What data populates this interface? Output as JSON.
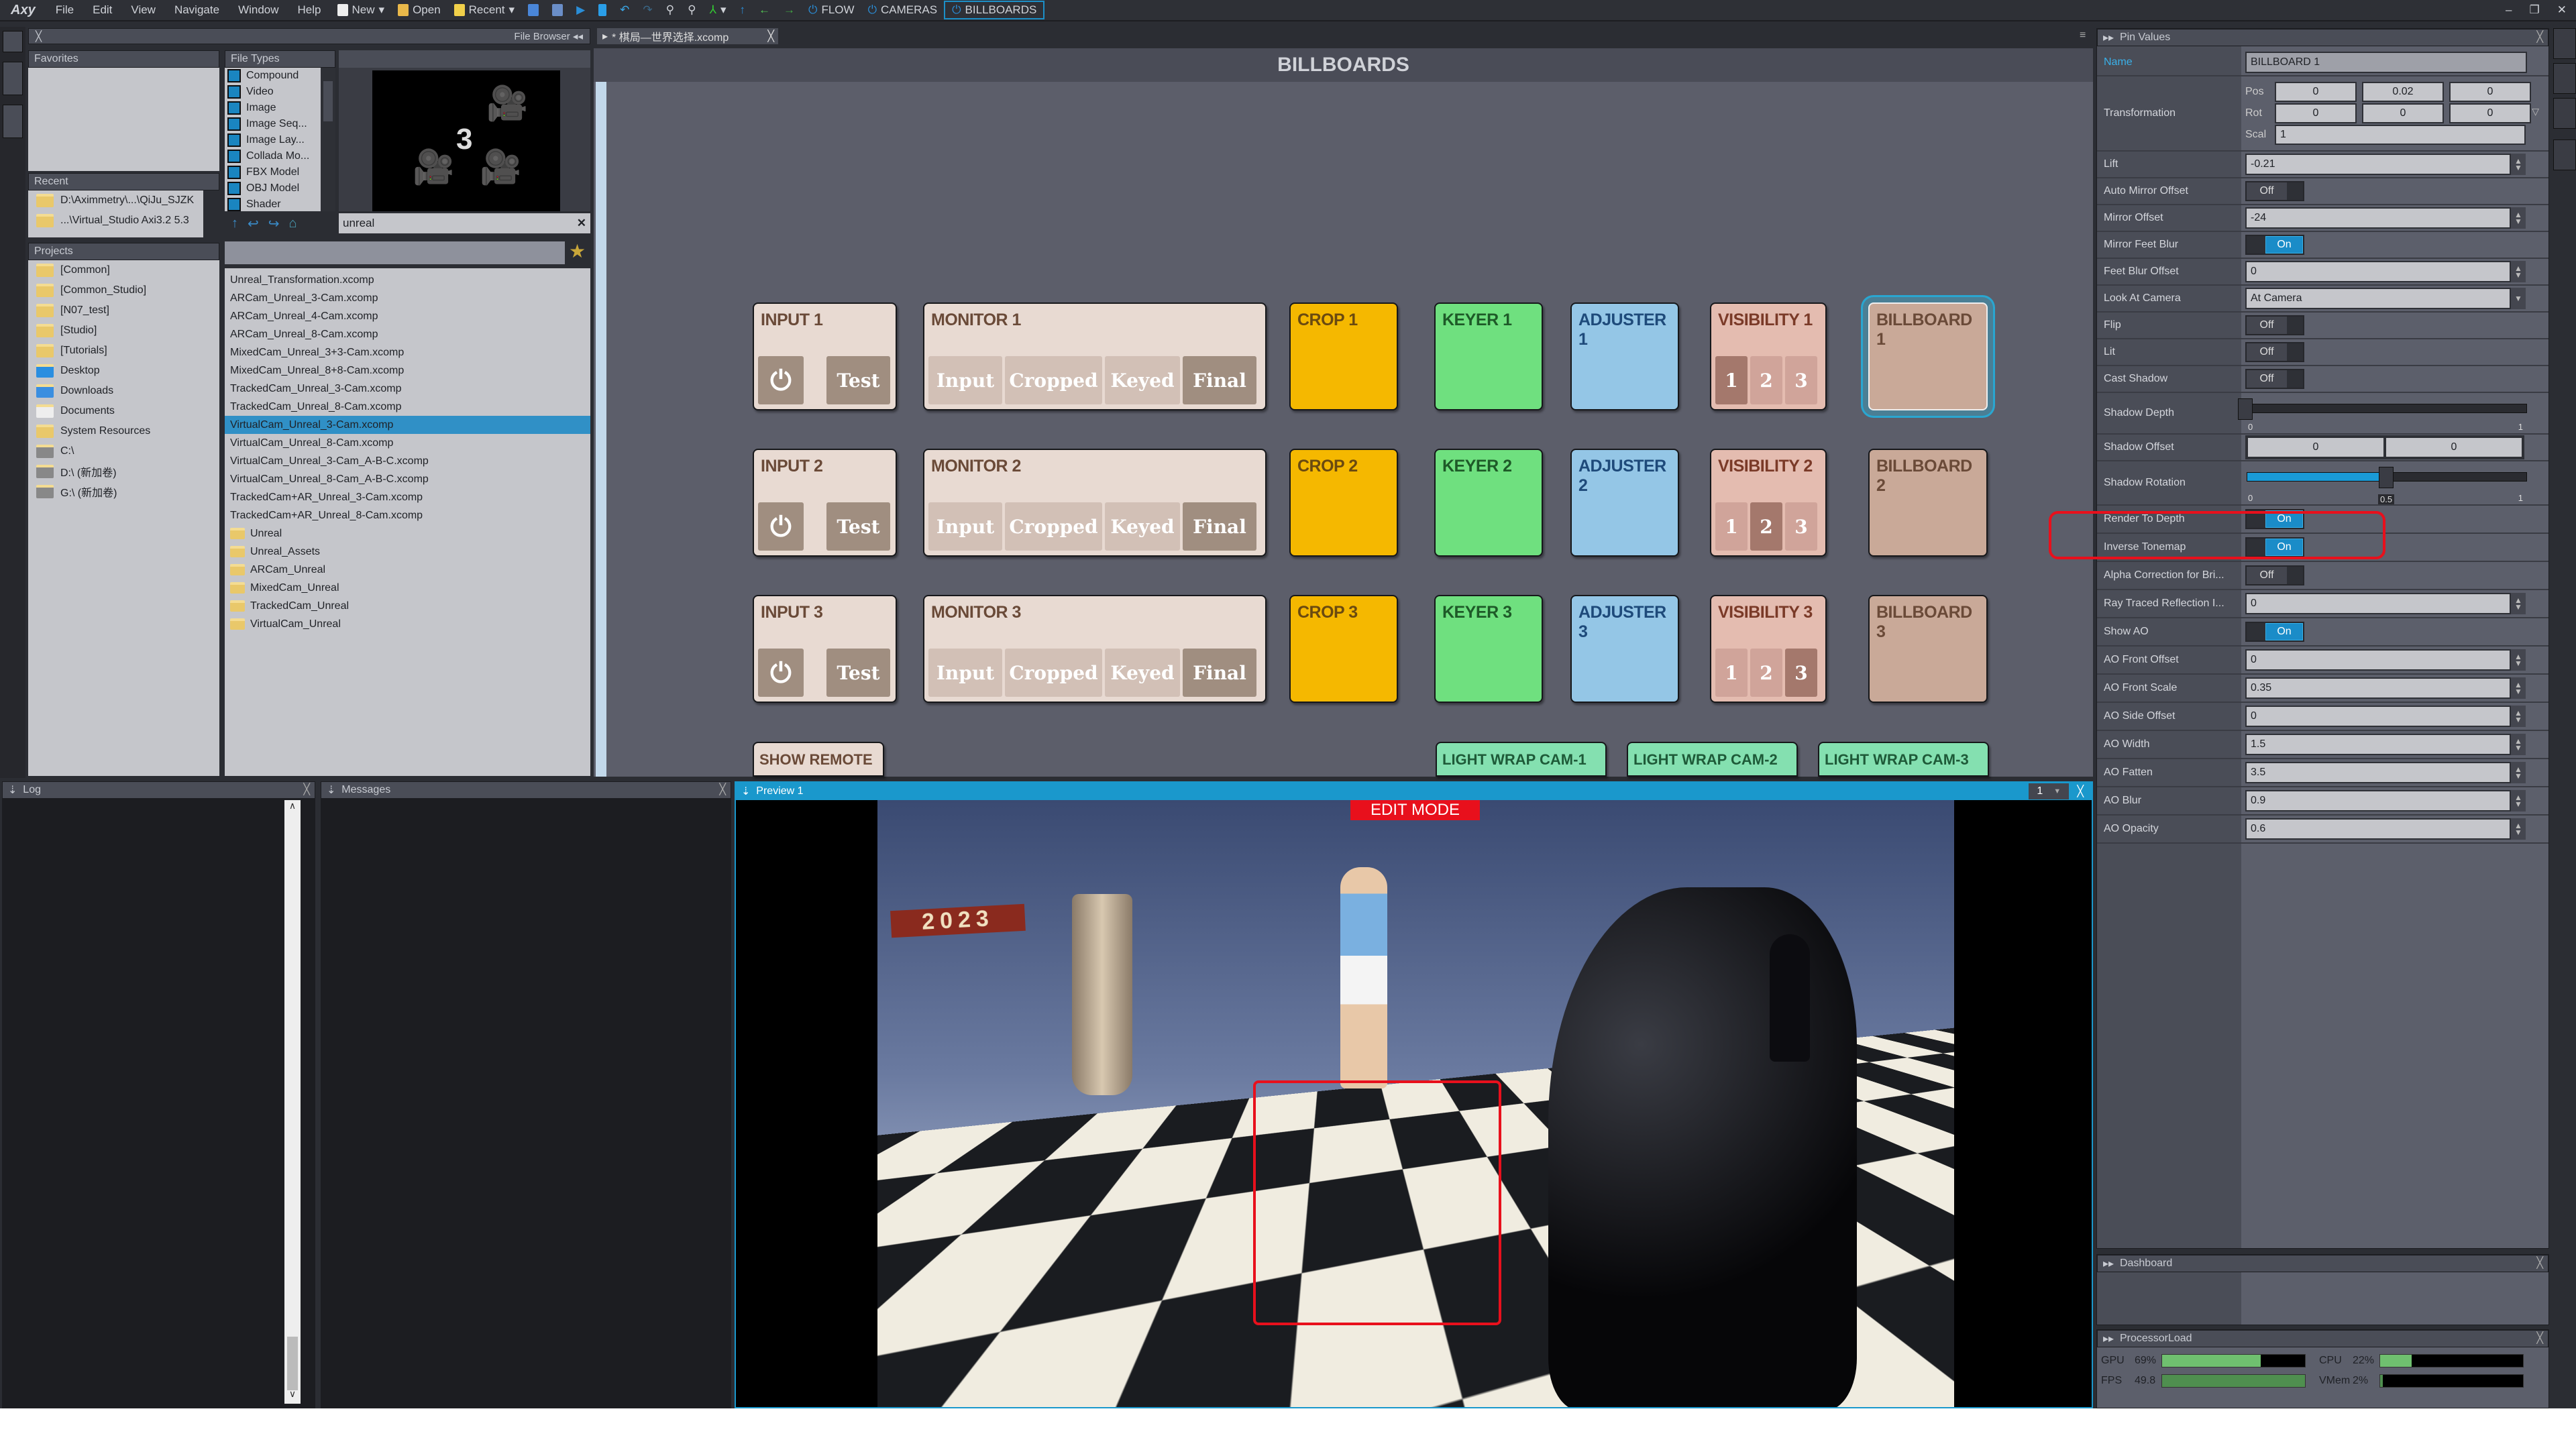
{
  "menu": {
    "logo": "Axy",
    "items": [
      "File",
      "Edit",
      "View",
      "Navigate",
      "Window",
      "Help"
    ],
    "toolbar": {
      "new": "New",
      "open": "Open",
      "recent": "Recent",
      "flow": "FLOW",
      "cameras": "CAMERAS",
      "billboards": "BILLBOARDS"
    }
  },
  "file_browser": {
    "title": "File Browser",
    "favorites_title": "Favorites",
    "recent_title": "Recent",
    "recent": [
      "D:\\Aximmetry\\...\\QiJu_SJZK",
      "...\\Virtual_Studio Axi3.2 5.3"
    ],
    "projects_title": "Projects",
    "projects": [
      {
        "label": "[Common]",
        "icon": "project-folder"
      },
      {
        "label": "[Common_Studio]",
        "icon": "project-folder"
      },
      {
        "label": "[N07_test]",
        "icon": "project-folder"
      },
      {
        "label": "[Studio]",
        "icon": "project-folder"
      },
      {
        "label": "[Tutorials]",
        "icon": "project-folder"
      },
      {
        "label": "Desktop",
        "icon": "desktop"
      },
      {
        "label": "Downloads",
        "icon": "download-arrow"
      },
      {
        "label": "Documents",
        "icon": "document"
      },
      {
        "label": "System Resources",
        "icon": "system-folder"
      },
      {
        "label": "C:\\",
        "icon": "drive"
      },
      {
        "label": "D:\\ (新加卷)",
        "icon": "drive"
      },
      {
        "label": "G:\\ (新加卷)",
        "icon": "drive"
      }
    ],
    "file_types_title": "File Types",
    "file_types": [
      "Compound",
      "Video",
      "Image",
      "Image Seq...",
      "Image Lay...",
      "Collada Mo...",
      "FBX Model",
      "OBJ Model",
      "Shader"
    ],
    "thumbnail_number": "3",
    "search_value": "unreal",
    "files": [
      "Unreal_Transformation.xcomp",
      "ARCam_Unreal_3-Cam.xcomp",
      "ARCam_Unreal_4-Cam.xcomp",
      "ARCam_Unreal_8-Cam.xcomp",
      "MixedCam_Unreal_3+3-Cam.xcomp",
      "MixedCam_Unreal_8+8-Cam.xcomp",
      "TrackedCam_Unreal_3-Cam.xcomp",
      "TrackedCam_Unreal_8-Cam.xcomp",
      "VirtualCam_Unreal_3-Cam.xcomp",
      "VirtualCam_Unreal_8-Cam.xcomp",
      "VirtualCam_Unreal_3-Cam_A-B-C.xcomp",
      "VirtualCam_Unreal_8-Cam_A-B-C.xcomp",
      "TrackedCam+AR_Unreal_3-Cam.xcomp",
      "TrackedCam+AR_Unreal_8-Cam.xcomp"
    ],
    "selected_file": "VirtualCam_Unreal_3-Cam.xcomp",
    "folders": [
      "Unreal",
      "Unreal_Assets",
      "ARCam_Unreal",
      "MixedCam_Unreal",
      "TrackedCam_Unreal",
      "VirtualCam_Unreal"
    ]
  },
  "editor": {
    "tab": "* 棋局—世界选择.xcomp",
    "title": "BILLBOARDS",
    "rows": [
      {
        "input": "INPUT 1",
        "monitor": "MONITOR 1",
        "crop": "CROP 1",
        "keyer": "KEYER 1",
        "adjuster": "ADJUSTER 1",
        "visibility": "VISIBILITY 1",
        "visibility_active": "1",
        "billboard": "BILLBOARD 1",
        "selected": true
      },
      {
        "input": "INPUT 2",
        "monitor": "MONITOR 2",
        "crop": "CROP 2",
        "keyer": "KEYER 2",
        "adjuster": "ADJUSTER 2",
        "visibility": "VISIBILITY 2",
        "visibility_active": "2",
        "billboard": "BILLBOARD 2",
        "selected": false
      },
      {
        "input": "INPUT 3",
        "monitor": "MONITOR 3",
        "crop": "CROP 3",
        "keyer": "KEYER 3",
        "adjuster": "ADJUSTER 3",
        "visibility": "VISIBILITY 3",
        "visibility_active": "3",
        "billboard": "BILLBOARD 3",
        "selected": false
      }
    ],
    "test_label": "Test",
    "monitor_buttons": [
      "Input",
      "Cropped",
      "Keyed",
      "Final"
    ],
    "monitor_active": "Final",
    "visibility_buttons": [
      "1",
      "2",
      "3"
    ],
    "show_remote": "SHOW REMOTE",
    "light_wrap": [
      "LIGHT WRAP CAM-1",
      "LIGHT WRAP CAM-2",
      "LIGHT WRAP CAM-3"
    ],
    "colors": {
      "input": "#e8dad2",
      "crop": "#f5b800",
      "keyer": "#6fe07f",
      "adjuster": "#94c6e6",
      "visibility": "#e4bcb0",
      "billboard": "#c9a998",
      "light_wrap": "#84e0b0",
      "selection": "#2aa6d0"
    }
  },
  "log": {
    "title": "Log"
  },
  "messages": {
    "title": "Messages"
  },
  "preview": {
    "title": "Preview 1",
    "index": "1",
    "edit_mode": "EDIT MODE",
    "sign": "2023"
  },
  "pin_values": {
    "title": "Pin Values",
    "name_label": "Name",
    "name_value": "BILLBOARD 1",
    "transformation": {
      "label": "Transformation",
      "pos_label": "Pos",
      "pos": [
        "0",
        "0.02",
        "0"
      ],
      "rot_label": "Rot",
      "rot": [
        "0",
        "0",
        "0"
      ],
      "scal_label": "Scal",
      "scal": "1"
    },
    "rows": [
      {
        "label": "Lift",
        "type": "number",
        "value": "-0.21"
      },
      {
        "label": "Auto Mirror Offset",
        "type": "toggle",
        "value": "Off"
      },
      {
        "label": "Mirror Offset",
        "type": "number",
        "value": "-24"
      },
      {
        "label": "Mirror Feet Blur",
        "type": "toggle",
        "value": "On"
      },
      {
        "label": "Feet Blur Offset",
        "type": "number",
        "value": "0"
      },
      {
        "label": "Look At Camera",
        "type": "select",
        "value": "At Camera"
      },
      {
        "label": "Flip",
        "type": "toggle",
        "value": "Off"
      },
      {
        "label": "Lit",
        "type": "toggle",
        "value": "Off"
      },
      {
        "label": "Cast Shadow",
        "type": "toggle",
        "value": "Off"
      },
      {
        "label": "Shadow Depth",
        "type": "slider",
        "value": 0,
        "min": "0",
        "max": "1",
        "readout": "0"
      },
      {
        "label": "Shadow Offset",
        "type": "pair",
        "values": [
          "0",
          "0"
        ]
      },
      {
        "label": "Shadow Rotation",
        "type": "slider",
        "value": 0.5,
        "min": "0",
        "max": "1",
        "readout": "0.5"
      },
      {
        "label": "Render To Depth",
        "type": "toggle",
        "value": "On",
        "highlighted": true
      },
      {
        "label": "Inverse Tonemap",
        "type": "toggle",
        "value": "On"
      },
      {
        "label": "Alpha Correction for Bri...",
        "type": "toggle",
        "value": "Off"
      },
      {
        "label": "Ray Traced Reflection I...",
        "type": "number",
        "value": "0"
      },
      {
        "label": "Show AO",
        "type": "toggle",
        "value": "On"
      },
      {
        "label": "AO Front Offset",
        "type": "number",
        "value": "0"
      },
      {
        "label": "AO Front Scale",
        "type": "number",
        "value": "0.35"
      },
      {
        "label": "AO Side Offset",
        "type": "number",
        "value": "0"
      },
      {
        "label": "AO Width",
        "type": "number",
        "value": "1.5"
      },
      {
        "label": "AO Fatten",
        "type": "number",
        "value": "3.5"
      },
      {
        "label": "AO Blur",
        "type": "number",
        "value": "0.9"
      },
      {
        "label": "AO Opacity",
        "type": "number",
        "value": "0.6"
      }
    ]
  },
  "dashboard": {
    "title": "Dashboard"
  },
  "processor_load": {
    "title": "ProcessorLoad",
    "gpu_label": "GPU",
    "gpu": "69%",
    "gpu_value": 69,
    "cpu_label": "CPU",
    "cpu": "22%",
    "cpu_value": 22,
    "fps_label": "FPS",
    "fps": "49.8",
    "fps_value": 100,
    "vmem_label": "VMem",
    "vmem": "2%",
    "vmem_value": 2
  }
}
